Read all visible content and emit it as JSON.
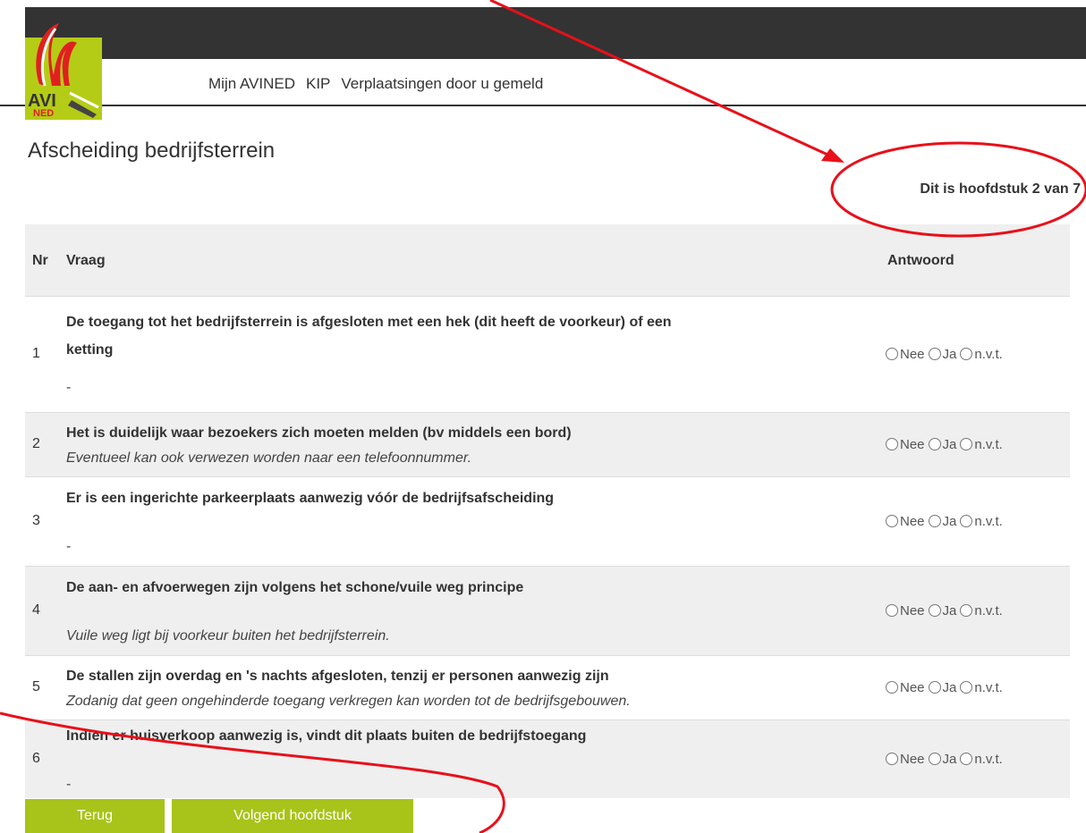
{
  "logo": {
    "line1": "AVI",
    "line2": "NED"
  },
  "nav": {
    "items": [
      {
        "label": "Mijn AVINED"
      },
      {
        "label": "KIP"
      },
      {
        "label": "Verplaatsingen door u gemeld"
      }
    ]
  },
  "page": {
    "title": "Afscheiding bedrijfsterrein",
    "chapter": "Dit is hoofdstuk 2 van 7"
  },
  "table": {
    "headers": {
      "nr": "Nr",
      "question": "Vraag",
      "answer": "Antwoord"
    },
    "answer_options": [
      "Nee",
      "Ja",
      "n.v.t."
    ],
    "rows": [
      {
        "nr": "1",
        "lines": [
          "De toegang tot het bedrijfsterrein is afgesloten met een hek (dit heeft de voorkeur) of een",
          "ketting"
        ],
        "note": "-"
      },
      {
        "nr": "2",
        "lines": [
          "Het is duidelijk waar bezoekers zich moeten melden (bv middels een bord)"
        ],
        "note": "Eventueel kan ook verwezen worden naar een telefoonnummer."
      },
      {
        "nr": "3",
        "lines": [
          "Er is een ingerichte parkeerplaats aanwezig vóór de bedrijfsafscheiding"
        ],
        "note": "-"
      },
      {
        "nr": "4",
        "lines": [
          "De aan- en afvoerwegen zijn volgens het schone/vuile weg principe"
        ],
        "note": "Vuile weg ligt bij voorkeur buiten het bedrijfsterrein."
      },
      {
        "nr": "5",
        "lines": [
          "De stallen zijn overdag en 's nachts afgesloten, tenzij er personen aanwezig zijn"
        ],
        "note": "Zodanig dat geen ongehinderde toegang verkregen kan worden tot de bedrijfsgebouwen."
      },
      {
        "nr": "6",
        "lines": [
          "Indien er huisverkoop aanwezig is, vindt dit plaats buiten de bedrijfstoegang"
        ],
        "note": "-"
      }
    ]
  },
  "buttons": {
    "back": "Terug",
    "next": "Volgend hoofdstuk"
  },
  "colors": {
    "accent": "#a8c31a",
    "topbar": "#333333",
    "annotation": "#e8101a"
  }
}
